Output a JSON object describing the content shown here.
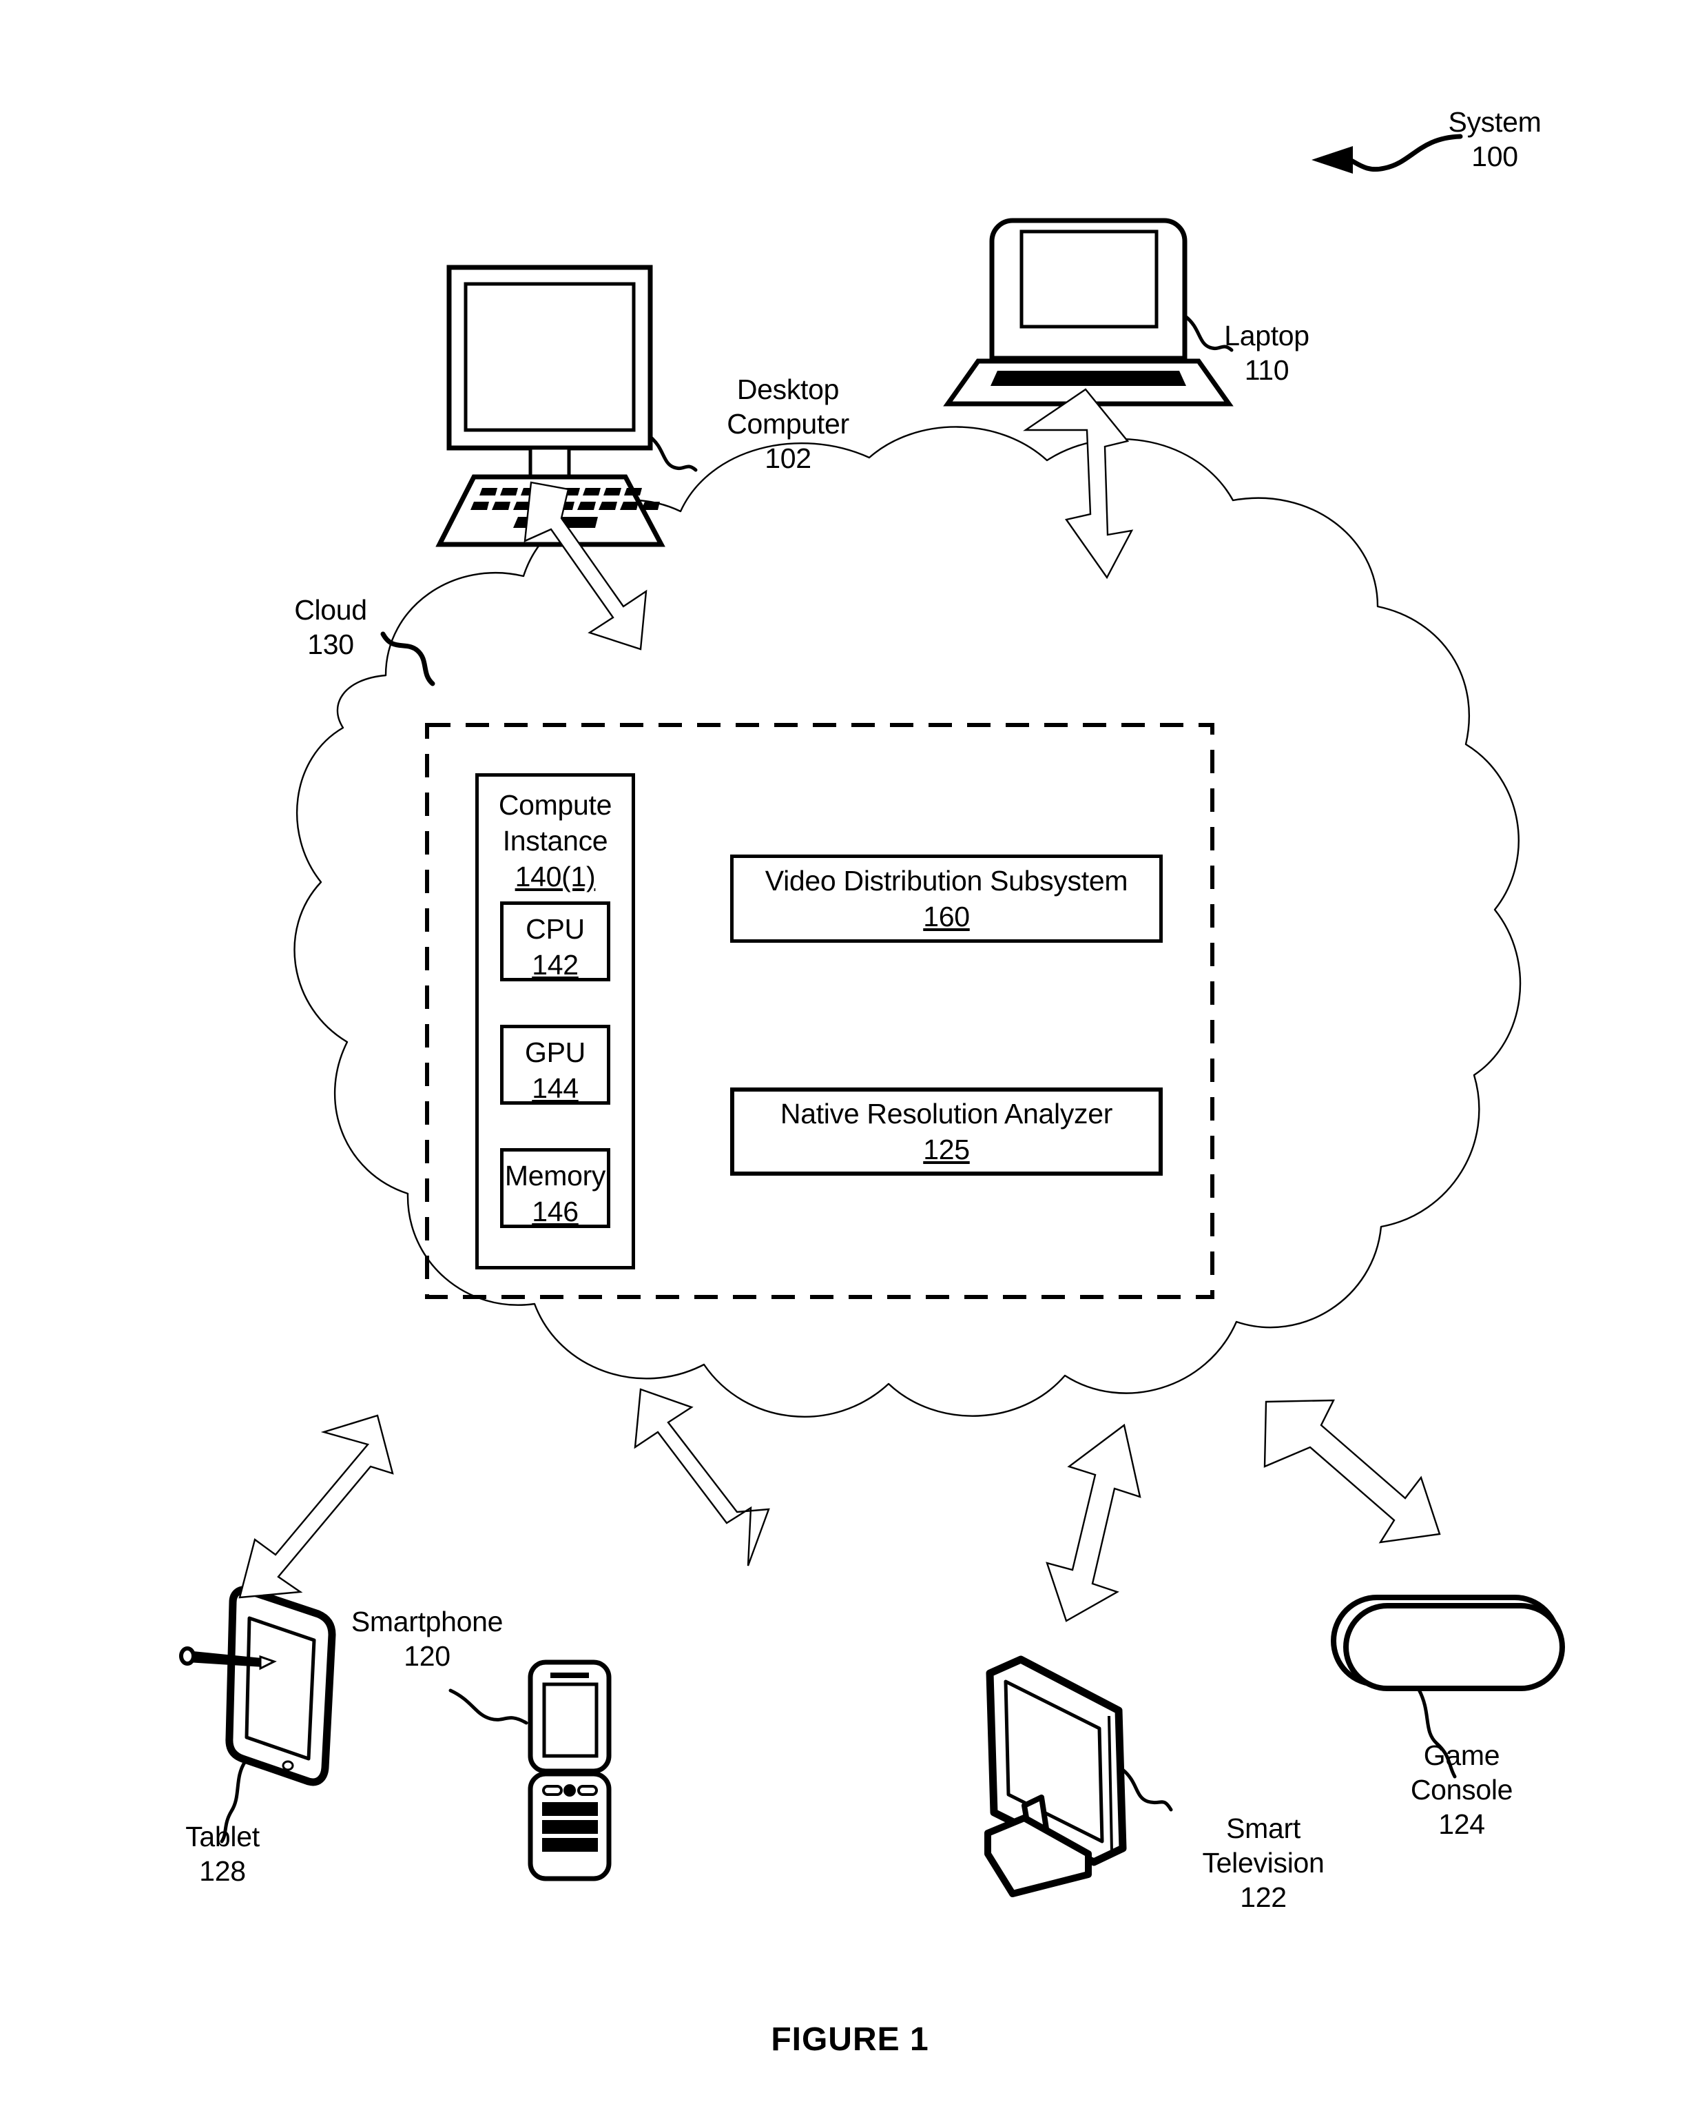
{
  "figure": {
    "caption": "FIGURE 1",
    "system_label": "System",
    "system_ref": "100"
  },
  "cloud": {
    "label": "Cloud",
    "ref": "130"
  },
  "compute_instance": {
    "line1": "Compute",
    "line2": "Instance",
    "ref": "140(1)",
    "components": [
      {
        "name": "CPU",
        "ref": "142"
      },
      {
        "name": "GPU",
        "ref": "144"
      },
      {
        "name": "Memory",
        "ref": "146"
      }
    ]
  },
  "subsystems": [
    {
      "name": "Video Distribution Subsystem",
      "ref": "160",
      "emphasis": "normal"
    },
    {
      "name": "Native Resolution Analyzer",
      "ref": "125",
      "emphasis": "bold"
    }
  ],
  "devices": [
    {
      "id": "desktop-computer",
      "line1": "Desktop",
      "line2": "Computer",
      "ref": "102"
    },
    {
      "id": "laptop",
      "line1": "Laptop",
      "line2": "",
      "ref": "110"
    },
    {
      "id": "tablet",
      "line1": "Tablet",
      "line2": "",
      "ref": "128"
    },
    {
      "id": "smartphone",
      "line1": "Smartphone",
      "line2": "",
      "ref": "120"
    },
    {
      "id": "smart-television",
      "line1": "Smart",
      "line2": "Television",
      "ref": "122"
    },
    {
      "id": "game-console",
      "line1": "Game",
      "line2": "Console",
      "ref": "124"
    }
  ],
  "colors": {
    "line": "#000000",
    "background": "#ffffff"
  }
}
